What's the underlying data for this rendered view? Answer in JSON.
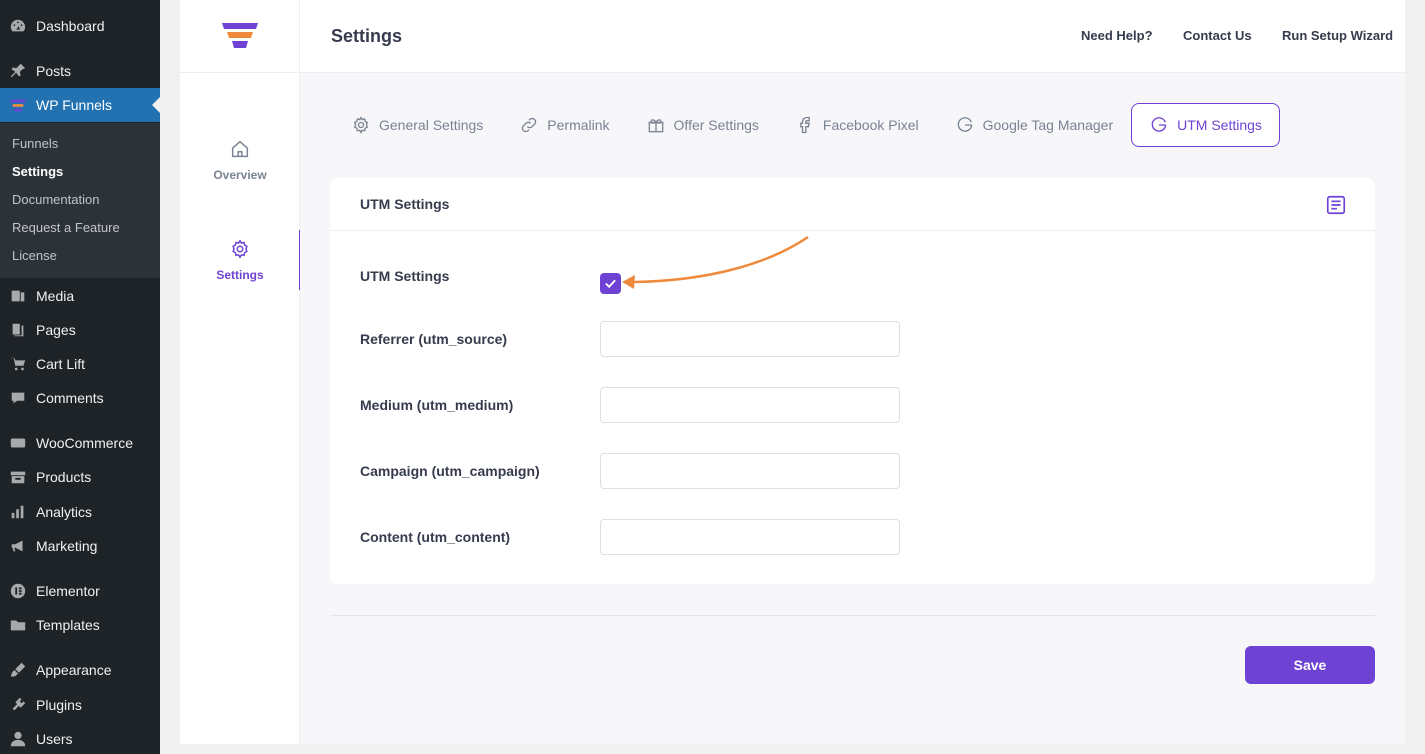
{
  "wp_sidebar": {
    "items": [
      {
        "label": "Dashboard",
        "icon": "dashboard-icon"
      },
      {
        "label": "Posts",
        "icon": "pin-icon"
      },
      {
        "label": "WP Funnels",
        "icon": "funnel-icon"
      },
      {
        "label": "Media",
        "icon": "media-icon"
      },
      {
        "label": "Pages",
        "icon": "pages-icon"
      },
      {
        "label": "Cart Lift",
        "icon": "cart-icon"
      },
      {
        "label": "Comments",
        "icon": "comment-icon"
      },
      {
        "label": "WooCommerce",
        "icon": "woo-icon"
      },
      {
        "label": "Products",
        "icon": "archive-icon"
      },
      {
        "label": "Analytics",
        "icon": "bar-chart-icon"
      },
      {
        "label": "Marketing",
        "icon": "megaphone-icon"
      },
      {
        "label": "Elementor",
        "icon": "elementor-icon"
      },
      {
        "label": "Templates",
        "icon": "folder-icon"
      },
      {
        "label": "Appearance",
        "icon": "brush-icon"
      },
      {
        "label": "Plugins",
        "icon": "plug-icon"
      },
      {
        "label": "Users",
        "icon": "user-icon"
      }
    ],
    "submenu": [
      "Funnels",
      "Settings",
      "Documentation",
      "Request a Feature",
      "License"
    ]
  },
  "plugin_nav": {
    "overview_label": "Overview",
    "settings_label": "Settings"
  },
  "header": {
    "title": "Settings",
    "links": [
      "Need Help?",
      "Contact Us",
      "Run Setup Wizard"
    ]
  },
  "tabs": [
    {
      "label": "General Settings",
      "icon": "gear-icon"
    },
    {
      "label": "Permalink",
      "icon": "link-icon"
    },
    {
      "label": "Offer Settings",
      "icon": "gift-icon"
    },
    {
      "label": "Facebook Pixel",
      "icon": "facebook-icon"
    },
    {
      "label": "Google Tag Manager",
      "icon": "google-icon"
    },
    {
      "label": "UTM Settings",
      "icon": "google-icon"
    }
  ],
  "card": {
    "title": "UTM Settings",
    "enable_label": "UTM Settings",
    "enabled": true,
    "fields": [
      {
        "label": "Referrer (utm_source)",
        "value": ""
      },
      {
        "label": "Medium (utm_medium)",
        "value": ""
      },
      {
        "label": "Campaign (utm_campaign)",
        "value": ""
      },
      {
        "label": "Content (utm_content)",
        "value": ""
      }
    ]
  },
  "save_label": "Save",
  "colors": {
    "accent": "#6e42d3",
    "wp_active": "#2271b1",
    "annotation_arrow": "#ef8a3c"
  }
}
